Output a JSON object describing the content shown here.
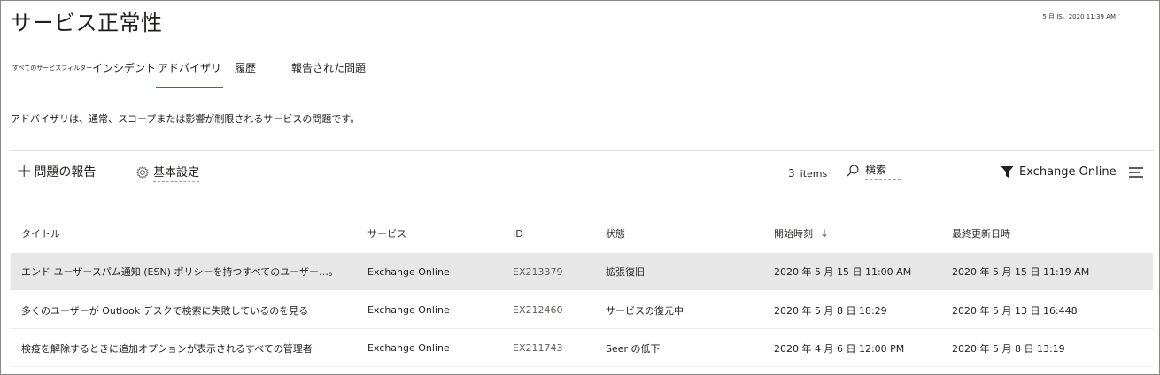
{
  "header": {
    "title": "サービス正常性",
    "timestamp": "5 月 IS。2020 11:39 AM"
  },
  "tabs": [
    {
      "label": "すべてのサービスフィルター",
      "active": false
    },
    {
      "label": "インシデント",
      "active": false
    },
    {
      "label": "アドバイザリ",
      "active": true
    },
    {
      "label": "履歴",
      "active": false
    },
    {
      "label": "報告された問題",
      "active": false
    }
  ],
  "description": "アドバイザリは、通常、スコープまたは影響が制限されるサービスの問題です。",
  "toolbar": {
    "report_label": "問題の報告",
    "settings_label": "基本設定",
    "count_value": "3",
    "count_unit": "items",
    "search_label": "検索",
    "filter_label": "Exchange Online"
  },
  "icons": {
    "report": "plus-icon",
    "settings": "gear-icon",
    "search": "search-icon",
    "filter": "filter-funnel-icon",
    "menu": "list-lines-icon",
    "sort": "arrow-down-icon"
  },
  "colors": {
    "accent": "#0078d4",
    "selected_row": "#e7e7e7"
  },
  "table": {
    "columns": [
      "タイトル",
      "サービス",
      "ID",
      "状態",
      "開始時刻",
      "最終更新日時"
    ],
    "sort_indicator": "↓",
    "rows": [
      [
        "エンド ユーザースパム通知 (ESN) ポリシーを持つすべてのユーザー…。",
        "Exchange Online",
        "EX213379",
        "拡張復旧",
        "2020 年 5 月 15 日 11:00 AM",
        "2020 年 5 月 15 日 11:19 AM"
      ],
      [
        "多くのユーザーが Outlook デスクで検索に失敗しているのを見る",
        "Exchange Online",
        "EX212460",
        "サービスの復元中",
        "2020 年 5 月 8 日 18:29",
        "2020 年 5 月 13 日 16:448"
      ],
      [
        "検疫を解除するときに追加オプションが表示されるすべての管理者",
        "Exchange Online",
        "EX211743",
        "Seer の低下",
        "2020 年 4 月 6 日 12:00 PM",
        "2020 年 5 月 8 日 13:19"
      ]
    ]
  }
}
